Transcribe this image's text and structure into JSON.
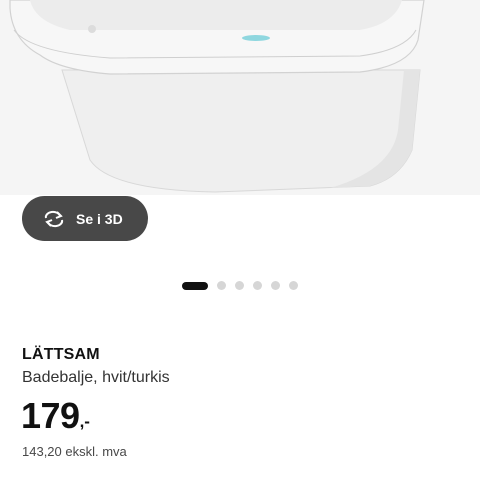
{
  "product_image": {
    "alt": "LÄTTSAM Badebalje"
  },
  "view_3d": {
    "label": "Se i 3D",
    "icon": "rotate-3d-icon"
  },
  "carousel": {
    "count": 6,
    "active_index": 0
  },
  "product": {
    "name": "LÄTTSAM",
    "description": "Badebalje, hvit/turkis",
    "price_main": "179",
    "price_suffix": ",-",
    "price_ex_vat": "143,20 ekskl. mva"
  },
  "colors": {
    "button_bg": "#484848",
    "accent_turquoise": "#8fd7df",
    "dot_active": "#111111",
    "dot_inactive": "#d6d6d6"
  }
}
